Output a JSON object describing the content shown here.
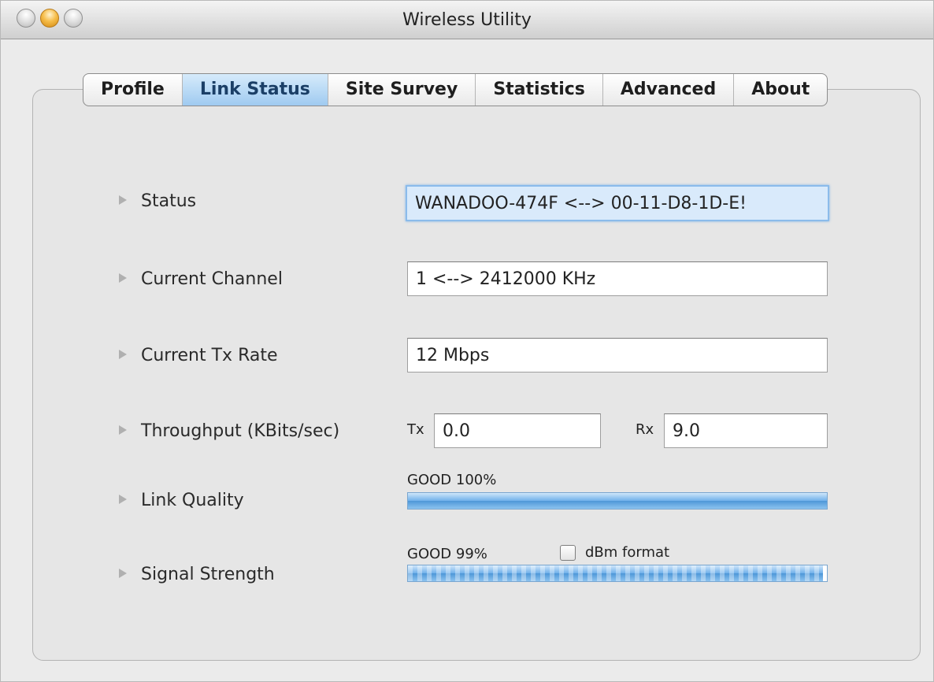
{
  "window": {
    "title": "Wireless Utility"
  },
  "tabs": [
    {
      "label": "Profile"
    },
    {
      "label": "Link Status",
      "active": true
    },
    {
      "label": "Site Survey"
    },
    {
      "label": "Statistics"
    },
    {
      "label": "Advanced"
    },
    {
      "label": "About"
    }
  ],
  "link_status": {
    "status": {
      "label": "Status",
      "value": "WANADOO-474F <--> 00-11-D8-1D-E!"
    },
    "channel": {
      "label": "Current Channel",
      "value": "1 <--> 2412000 KHz"
    },
    "tx_rate": {
      "label": "Current Tx Rate",
      "value": "12 Mbps"
    },
    "throughput": {
      "label": "Throughput (KBits/sec)",
      "tx_label": "Tx",
      "tx_value": "0.0",
      "rx_label": "Rx",
      "rx_value": "9.0"
    },
    "link_quality": {
      "label": "Link Quality",
      "text": "GOOD 100%",
      "percent": 100
    },
    "signal_strength": {
      "label": "Signal Strength",
      "text": "GOOD 99%",
      "percent": 99,
      "dbm_label": "dBm format",
      "dbm_checked": false
    }
  },
  "colors": {
    "active_tab": "#9fcaf0",
    "bar": "#4e97d8"
  },
  "icons": {
    "row_marker": "disclosure-triangle-icon"
  }
}
